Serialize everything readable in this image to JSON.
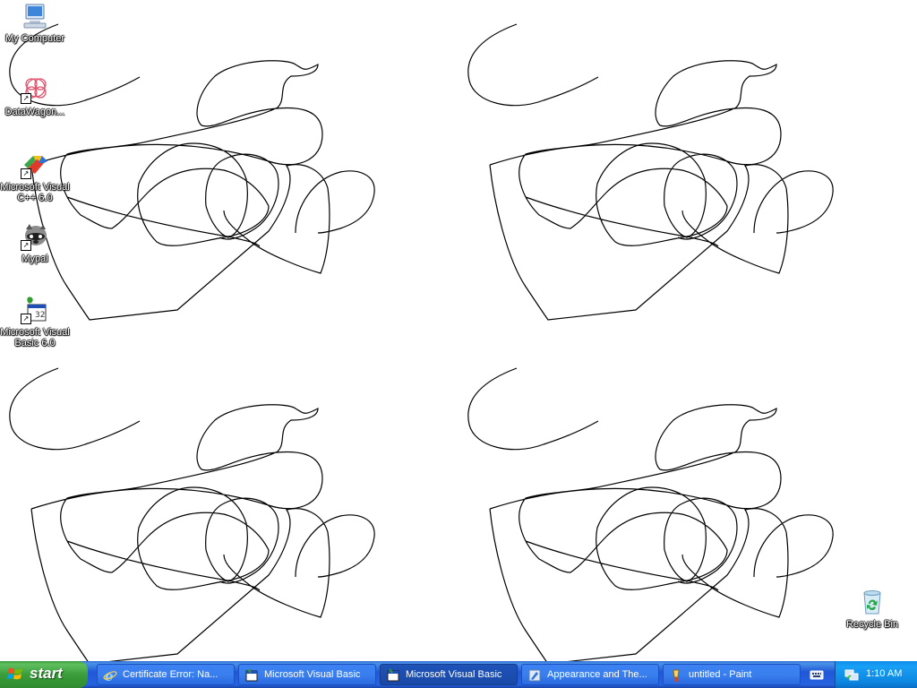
{
  "desktop": {
    "icons": [
      {
        "label": "My Computer"
      },
      {
        "label": "DataWagon..."
      },
      {
        "label": "Microsoft Visual C++ 6.0"
      },
      {
        "label": "Mypal"
      },
      {
        "label": "Microsoft Visual Basic 6.0"
      },
      {
        "label": "Recycle Bin"
      }
    ]
  },
  "taskbar": {
    "start_label": "start",
    "tasks": [
      {
        "label": "Certificate Error: Na...",
        "icon": "ie-icon"
      },
      {
        "label": "Microsoft Visual Basic",
        "icon": "vb-icon"
      },
      {
        "label": "Microsoft Visual Basic",
        "icon": "vb-icon",
        "active": true
      },
      {
        "label": "Appearance and The...",
        "icon": "control-panel-icon"
      },
      {
        "label": "untitled - Paint",
        "icon": "paint-icon"
      }
    ],
    "clock": "1:10 AM"
  },
  "colors": {
    "taskbar": "#245edb",
    "start": "#3a9d3a",
    "tray": "#0f8ee9"
  }
}
